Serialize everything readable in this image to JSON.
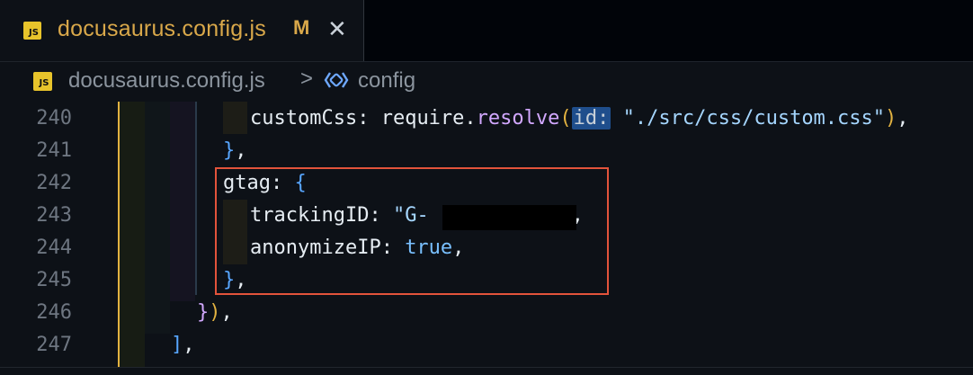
{
  "tab": {
    "icon_label": "JS",
    "title": "docusaurus.config.js",
    "modified": "M",
    "close": "✕"
  },
  "breadcrumb": {
    "icon_label": "JS",
    "file": "docusaurus.config.js",
    "separator": ">",
    "symbol_icon": "⟨⊙⟩",
    "symbol": "config"
  },
  "editor": {
    "line_numbers": [
      "240",
      "241",
      "242",
      "243",
      "244",
      "245",
      "246",
      "247"
    ],
    "lines": {
      "l240": {
        "a": "customCss: ",
        "b": "require.",
        "c": "resolve",
        "d": "(",
        "e": "id:",
        "f": " \"./src/css/custom.css\"",
        "g": ")",
        "h": ","
      },
      "l241": {
        "a": "}",
        "b": ","
      },
      "l242": {
        "a": "gtag: ",
        "b": "{"
      },
      "l243": {
        "a": "trackingID: ",
        "b": "\"G-",
        "c": "           ",
        "d": "\"",
        "e": ","
      },
      "l244": {
        "a": "anonymizeIP: ",
        "b": "true",
        "c": ","
      },
      "l245": {
        "a": "}",
        "b": ","
      },
      "l246": {
        "a": "}",
        "b": ")",
        "c": ","
      },
      "l247": {
        "a": "]",
        "b": ","
      }
    }
  }
}
